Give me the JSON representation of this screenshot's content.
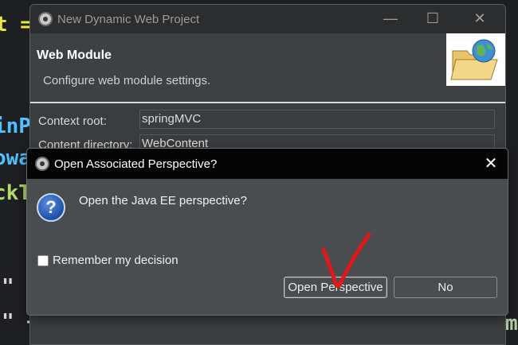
{
  "background_code": {
    "line1": "t =",
    "line2": "inP",
    "line3": "owa",
    "line4": "ckT",
    "line5": "\" +",
    "line6": "\" +",
    "line7": "m"
  },
  "wizard": {
    "title": "New Dynamic Web Project",
    "heading": "Web Module",
    "description": "Configure web module settings.",
    "fields": [
      {
        "label": "Context root:",
        "value": "springMVC"
      },
      {
        "label": "Content directory:",
        "value": "WebContent"
      }
    ],
    "controls": {
      "minimize": "—",
      "maximize": "☐",
      "close": "✕"
    }
  },
  "dialog": {
    "title": "Open Associated Perspective?",
    "close": "✕",
    "question": "Open the Java EE perspective?",
    "remember_label": "Remember my decision",
    "remember_checked": false,
    "buttons": {
      "open_perspective": "Open Perspective",
      "no": "No"
    }
  },
  "colors": {
    "annotation_red": "#e01818",
    "code_yellow": "#e8e840",
    "code_cyan": "#4fc1ff",
    "code_green": "#b5cea8"
  },
  "icons": {
    "app": "eclipse-icon",
    "question": "question-icon",
    "banner": "folder-globe-icon"
  }
}
